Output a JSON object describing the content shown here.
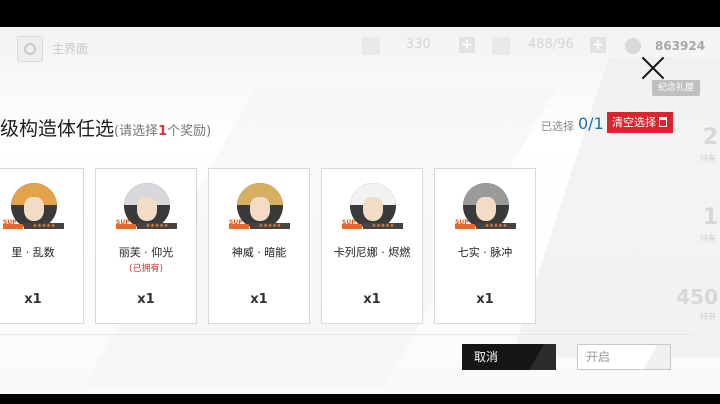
{
  "hud": {
    "home_label": "主界面",
    "resource_1": "330",
    "resource_2": "488/96",
    "coins": "863924",
    "memorial_gift": "纪念礼厘",
    "side_numbers": [
      "2",
      "1",
      "450"
    ],
    "side_subs": [
      "持有",
      "持有",
      "持有"
    ]
  },
  "dialog": {
    "title": "级构造体任选",
    "hint_prefix": "(请选择",
    "hint_count": "1",
    "hint_suffix": "个奖励)",
    "selected_label": "已选择",
    "selected_count": "0/1",
    "clear_label": "清空选择",
    "cards": [
      {
        "name": "里 · 乱数",
        "owned": "",
        "qty": "x1",
        "rank_tag": "SUP",
        "hair": "#e3a34a"
      },
      {
        "name": "丽芙 · 仰光",
        "owned": "(已拥有)",
        "qty": "x1",
        "rank_tag": "SUP",
        "hair": "#d8d8dc"
      },
      {
        "name": "神威 · 暗能",
        "owned": "",
        "qty": "x1",
        "rank_tag": "SUP",
        "hair": "#d6b060"
      },
      {
        "name": "卡列尼娜 · 烬燃",
        "owned": "",
        "qty": "x1",
        "rank_tag": "SUP",
        "hair": "#f2f2f2"
      },
      {
        "name": "七实 · 脉冲",
        "owned": "",
        "qty": "x1",
        "rank_tag": "SUP",
        "hair": "#9a9a9a"
      }
    ],
    "cancel_label": "取消",
    "open_label": "开启"
  },
  "colors": {
    "accent_red": "#d7262f",
    "count_blue": "#1c6fb0",
    "cancel_bg": "#151515"
  }
}
